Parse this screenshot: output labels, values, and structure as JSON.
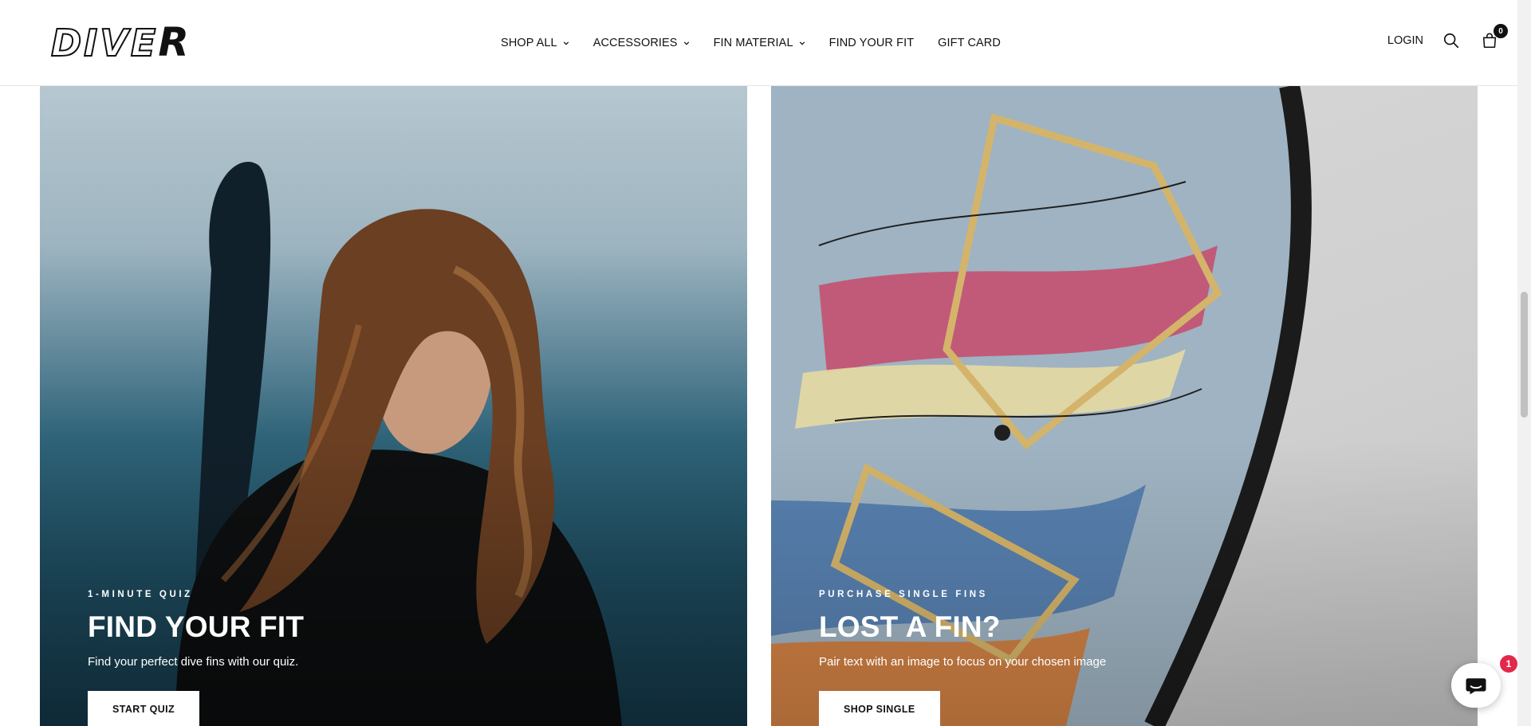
{
  "brand": {
    "logo_text": "DIVE",
    "logo_accent": "R"
  },
  "nav": {
    "items": [
      {
        "label": "SHOP ALL",
        "has_dropdown": true
      },
      {
        "label": "ACCESSORIES",
        "has_dropdown": true
      },
      {
        "label": "FIN MATERIAL",
        "has_dropdown": true
      },
      {
        "label": "FIND YOUR FIT",
        "has_dropdown": false
      },
      {
        "label": "GIFT CARD",
        "has_dropdown": false
      }
    ]
  },
  "header_actions": {
    "login_label": "LOGIN",
    "search_icon": "search-icon",
    "cart_icon": "cart-icon",
    "cart_count": "0"
  },
  "panels": [
    {
      "eyebrow": "1-MINUTE QUIZ",
      "title": "FIND YOUR FIT",
      "description": "Find your perfect dive fins with our quiz.",
      "cta_label": "START QUIZ"
    },
    {
      "eyebrow": "PURCHASE SINGLE FINS",
      "title": "LOST A FIN?",
      "description": "Pair text with an image to focus on your chosen image",
      "cta_label": "SHOP SINGLE"
    }
  ],
  "chat": {
    "icon": "chat-icon",
    "badge_count": "1",
    "badge_color": "#e3284b"
  },
  "colors": {
    "text": "#111111",
    "badge": "#e3284b"
  }
}
